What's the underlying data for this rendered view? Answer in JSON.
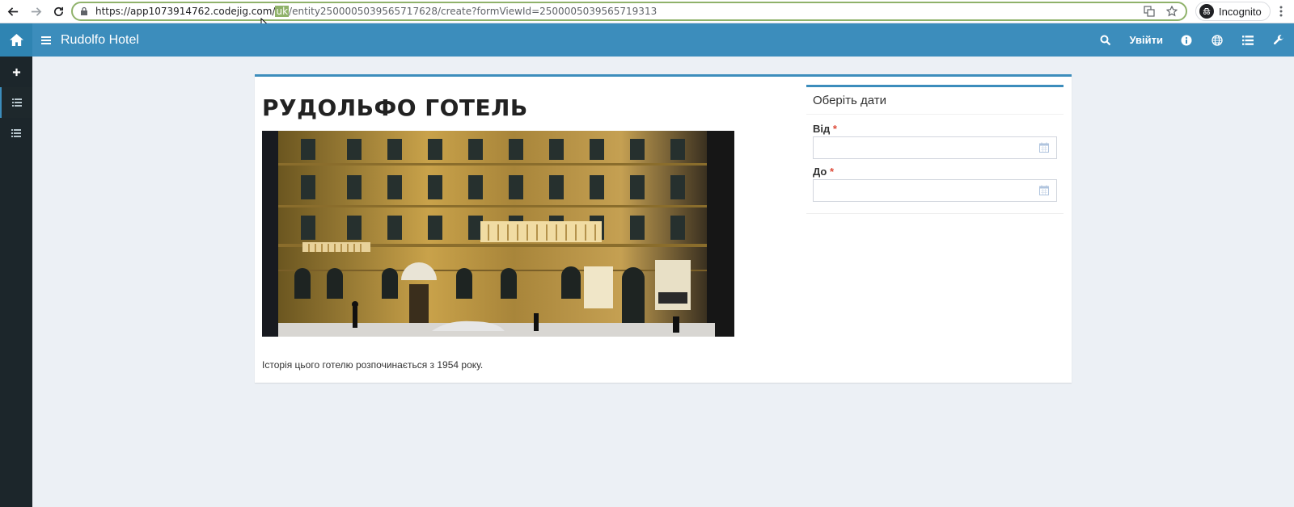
{
  "browser": {
    "url_prefix": "https://app1073914762.codejig.com/",
    "url_selected": "uk",
    "url_suffix": "/entity2500005039565717628/create?formViewId=2500005039565719313",
    "profile_label": "Incognito"
  },
  "header": {
    "app_title": "Rudolfo Hotel",
    "login_label": "Увійти"
  },
  "page": {
    "hotel_title": "РУДОЛЬФО ГОТЕЛЬ",
    "history_text": "Історія цього готелю розпочинається з 1954 року."
  },
  "date_box": {
    "title": "Оберіть дати",
    "from_label": "Від",
    "to_label": "До",
    "required_mark": "*"
  },
  "colors": {
    "header_blue": "#3c8dbc",
    "sidebar_dark": "#1c262b",
    "required_red": "#dd4b39"
  }
}
